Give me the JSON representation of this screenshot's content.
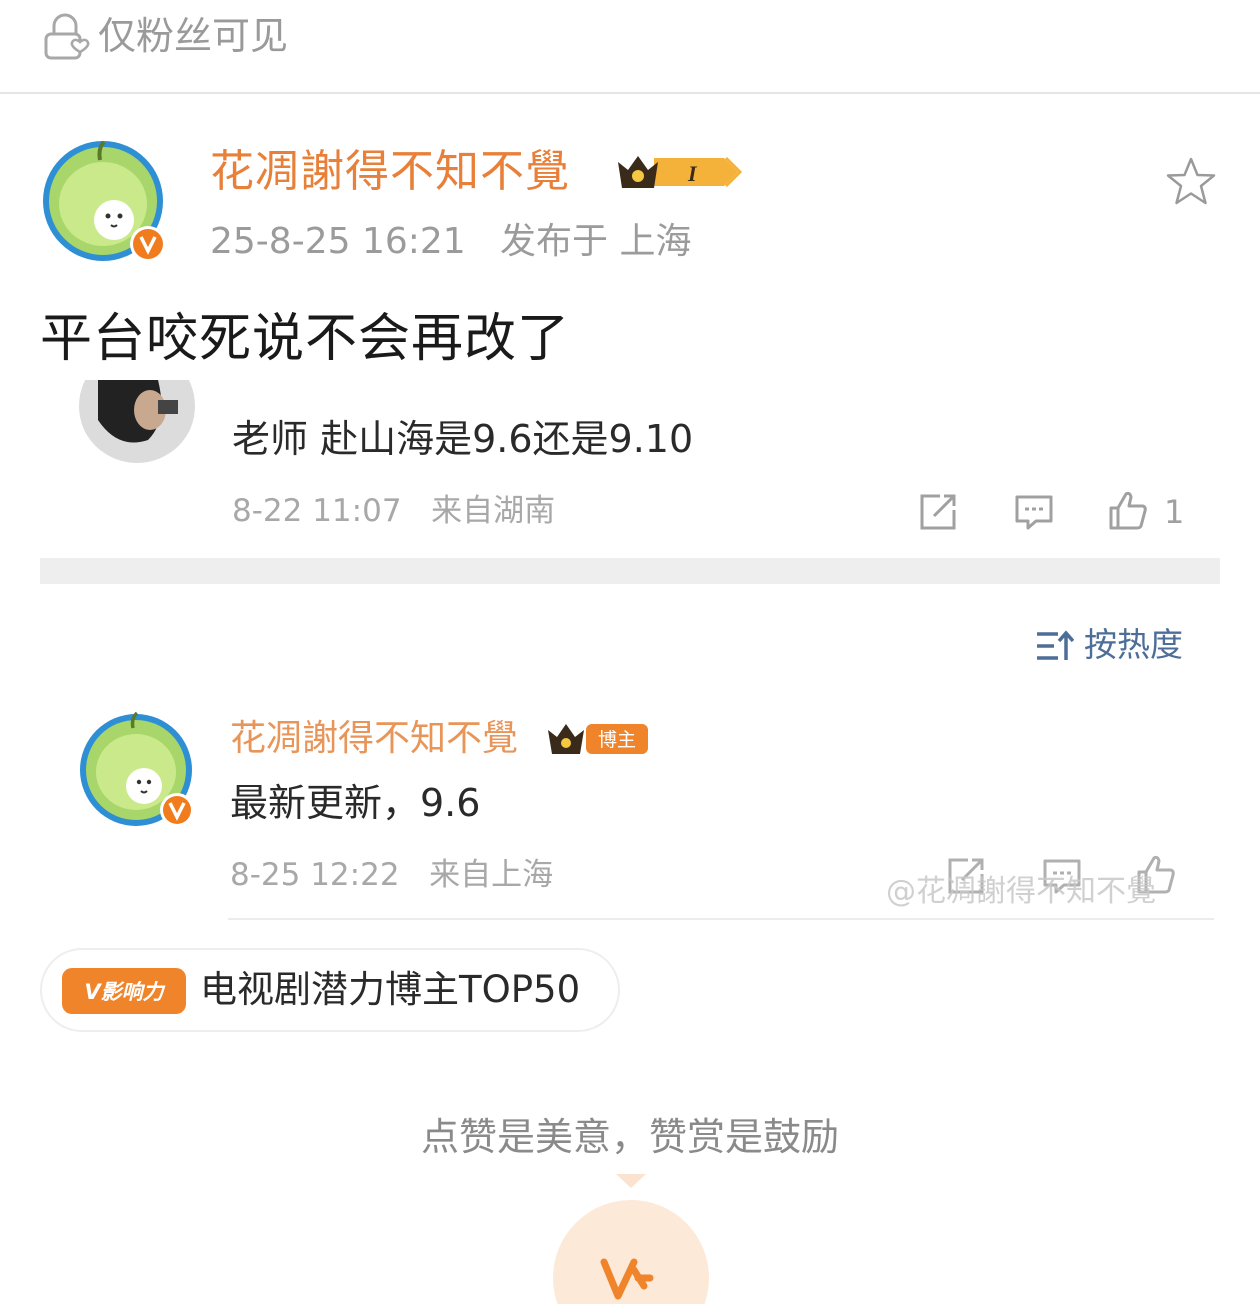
{
  "topbar": {
    "visibility_label": "仅粉丝可见"
  },
  "post": {
    "author_name": "花凋謝得不知不覺",
    "crown_level": "I",
    "timestamp": "25-8-25 16:21",
    "location": "发布于 上海",
    "text": "平台咬死说不会再改了"
  },
  "comment": {
    "text": "老师 赴山海是9.6还是9.10",
    "time": "8-22 11:07",
    "location": "来自湖南",
    "like_count": "1"
  },
  "sort": {
    "label": "按热度"
  },
  "reply": {
    "author_name": "花凋謝得不知不覺",
    "badge": "博主",
    "text": "最新更新，9.6",
    "time": "8-25 12:22",
    "location": "来自上海",
    "watermark": "@花凋謝得不知不覺"
  },
  "influence": {
    "badge": "V影响力",
    "text": "电视剧潜力博主TOP50"
  },
  "reward": {
    "hint": "点赞是美意，赞赏是鼓励"
  },
  "colors": {
    "accent_orange": "#e8803a",
    "link_blue": "#4d6e98",
    "muted_gray": "#9b9b9b"
  }
}
